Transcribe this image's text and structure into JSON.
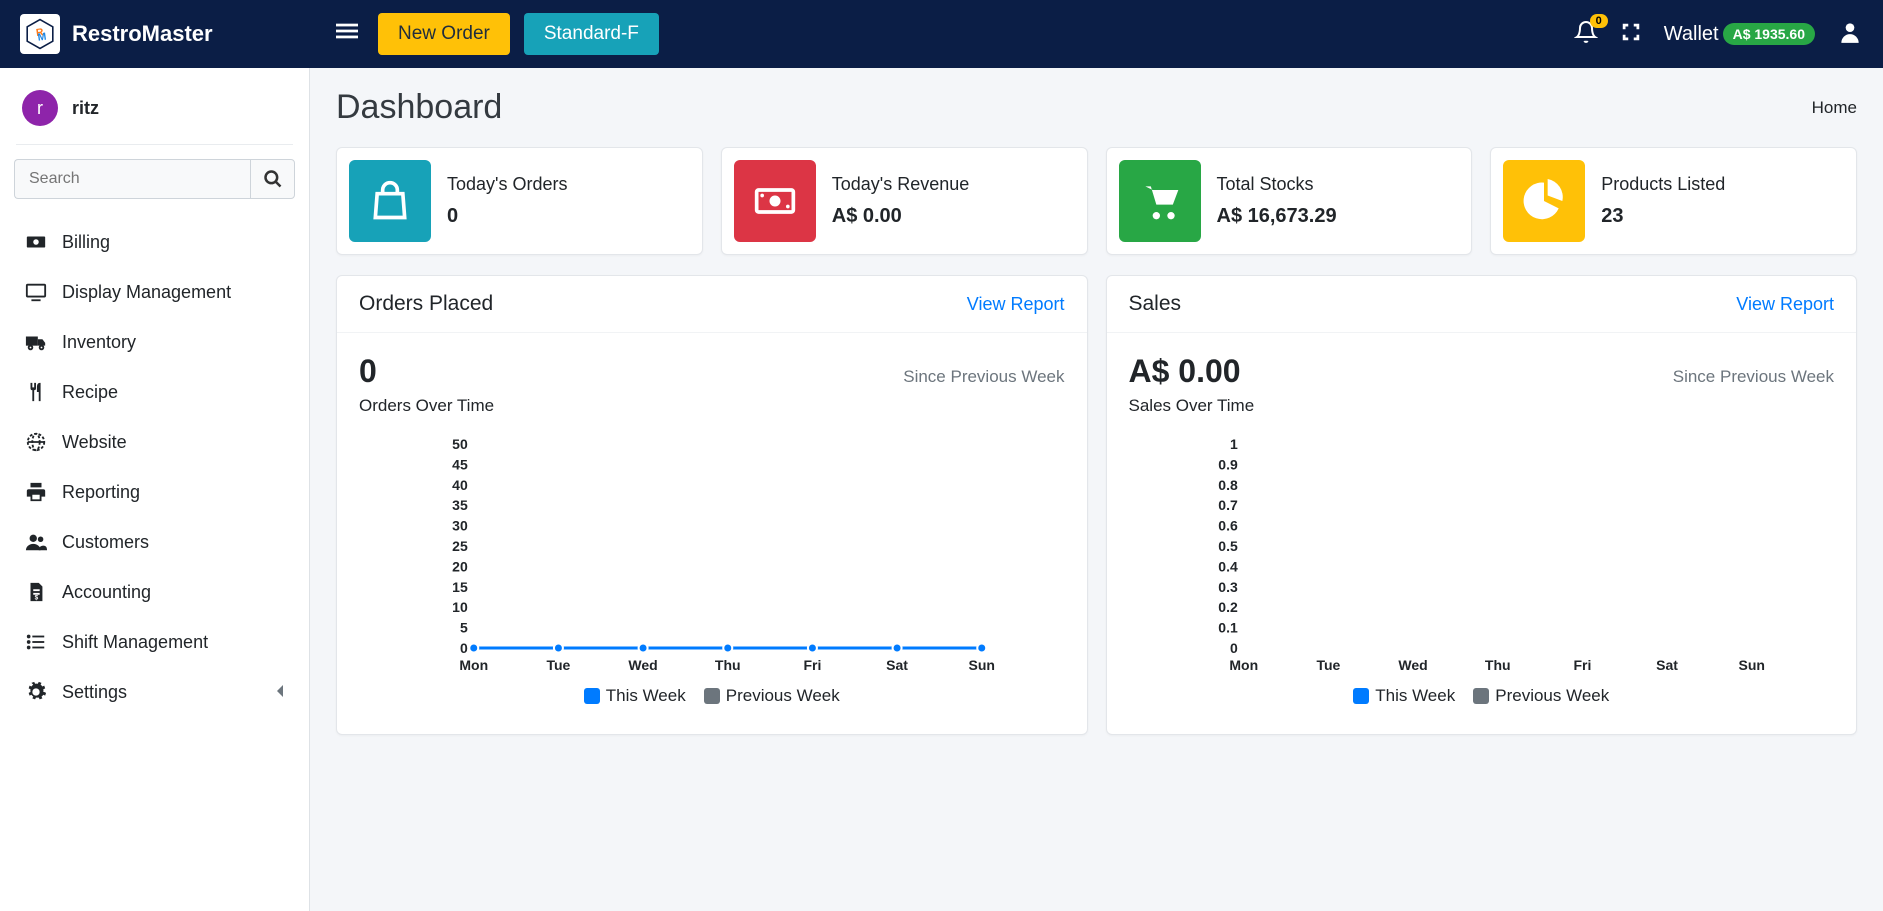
{
  "brand": {
    "name": "RestroMaster"
  },
  "nav": {
    "new_order": "New Order",
    "restaurant": "Standard-F",
    "notif_count": "0",
    "wallet_label": "Wallet",
    "wallet_amount": "A$ 1935.60"
  },
  "sidebar": {
    "user": {
      "initial": "r",
      "name": "ritz"
    },
    "search_placeholder": "Search",
    "items": [
      {
        "icon": "money",
        "label": "Billing"
      },
      {
        "icon": "display",
        "label": "Display Management"
      },
      {
        "icon": "truck",
        "label": "Inventory"
      },
      {
        "icon": "utensils",
        "label": "Recipe"
      },
      {
        "icon": "globe",
        "label": "Website"
      },
      {
        "icon": "print",
        "label": "Reporting"
      },
      {
        "icon": "users",
        "label": "Customers"
      },
      {
        "icon": "file-invoice",
        "label": "Accounting"
      },
      {
        "icon": "list",
        "label": "Shift Management"
      },
      {
        "icon": "gear",
        "label": "Settings",
        "has_sub": true
      }
    ]
  },
  "page": {
    "title": "Dashboard",
    "breadcrumb": "Home"
  },
  "stats": [
    {
      "label": "Today's Orders",
      "value": "0",
      "icon": "bag",
      "color": "bg-teal"
    },
    {
      "label": "Today's Revenue",
      "value": "A$ 0.00",
      "icon": "cash",
      "color": "bg-red"
    },
    {
      "label": "Total Stocks",
      "value": "A$ 16,673.29",
      "icon": "cart",
      "color": "bg-green"
    },
    {
      "label": "Products Listed",
      "value": "23",
      "icon": "pie",
      "color": "bg-yellow"
    }
  ],
  "charts": {
    "orders": {
      "title": "Orders Placed",
      "link": "View Report",
      "big": "0",
      "sub": "Since Previous Week",
      "caption": "Orders Over Time"
    },
    "sales": {
      "title": "Sales",
      "link": "View Report",
      "big": "A$ 0.00",
      "sub": "Since Previous Week",
      "caption": "Sales Over Time"
    },
    "legend": {
      "a": "This Week",
      "b": "Previous Week"
    }
  },
  "chart_data": [
    {
      "type": "line",
      "title": "Orders Over Time",
      "categories": [
        "Mon",
        "Tue",
        "Wed",
        "Thu",
        "Fri",
        "Sat",
        "Sun"
      ],
      "ylim": [
        0,
        50
      ],
      "yticks": [
        0,
        5,
        10,
        15,
        20,
        25,
        30,
        35,
        40,
        45,
        50
      ],
      "series": [
        {
          "name": "This Week",
          "values": [
            0,
            0,
            0,
            0,
            0,
            0,
            0
          ],
          "color": "#007bff"
        },
        {
          "name": "Previous Week",
          "values": [],
          "color": "#6c757d"
        }
      ]
    },
    {
      "type": "line",
      "title": "Sales Over Time",
      "categories": [
        "Mon",
        "Tue",
        "Wed",
        "Thu",
        "Fri",
        "Sat",
        "Sun"
      ],
      "ylim": [
        0,
        1
      ],
      "yticks": [
        0,
        0.1,
        0.2,
        0.3,
        0.4,
        0.5,
        0.6,
        0.7,
        0.8,
        0.9,
        1
      ],
      "series": [
        {
          "name": "This Week",
          "values": [],
          "color": "#007bff"
        },
        {
          "name": "Previous Week",
          "values": [],
          "color": "#6c757d"
        }
      ]
    }
  ]
}
